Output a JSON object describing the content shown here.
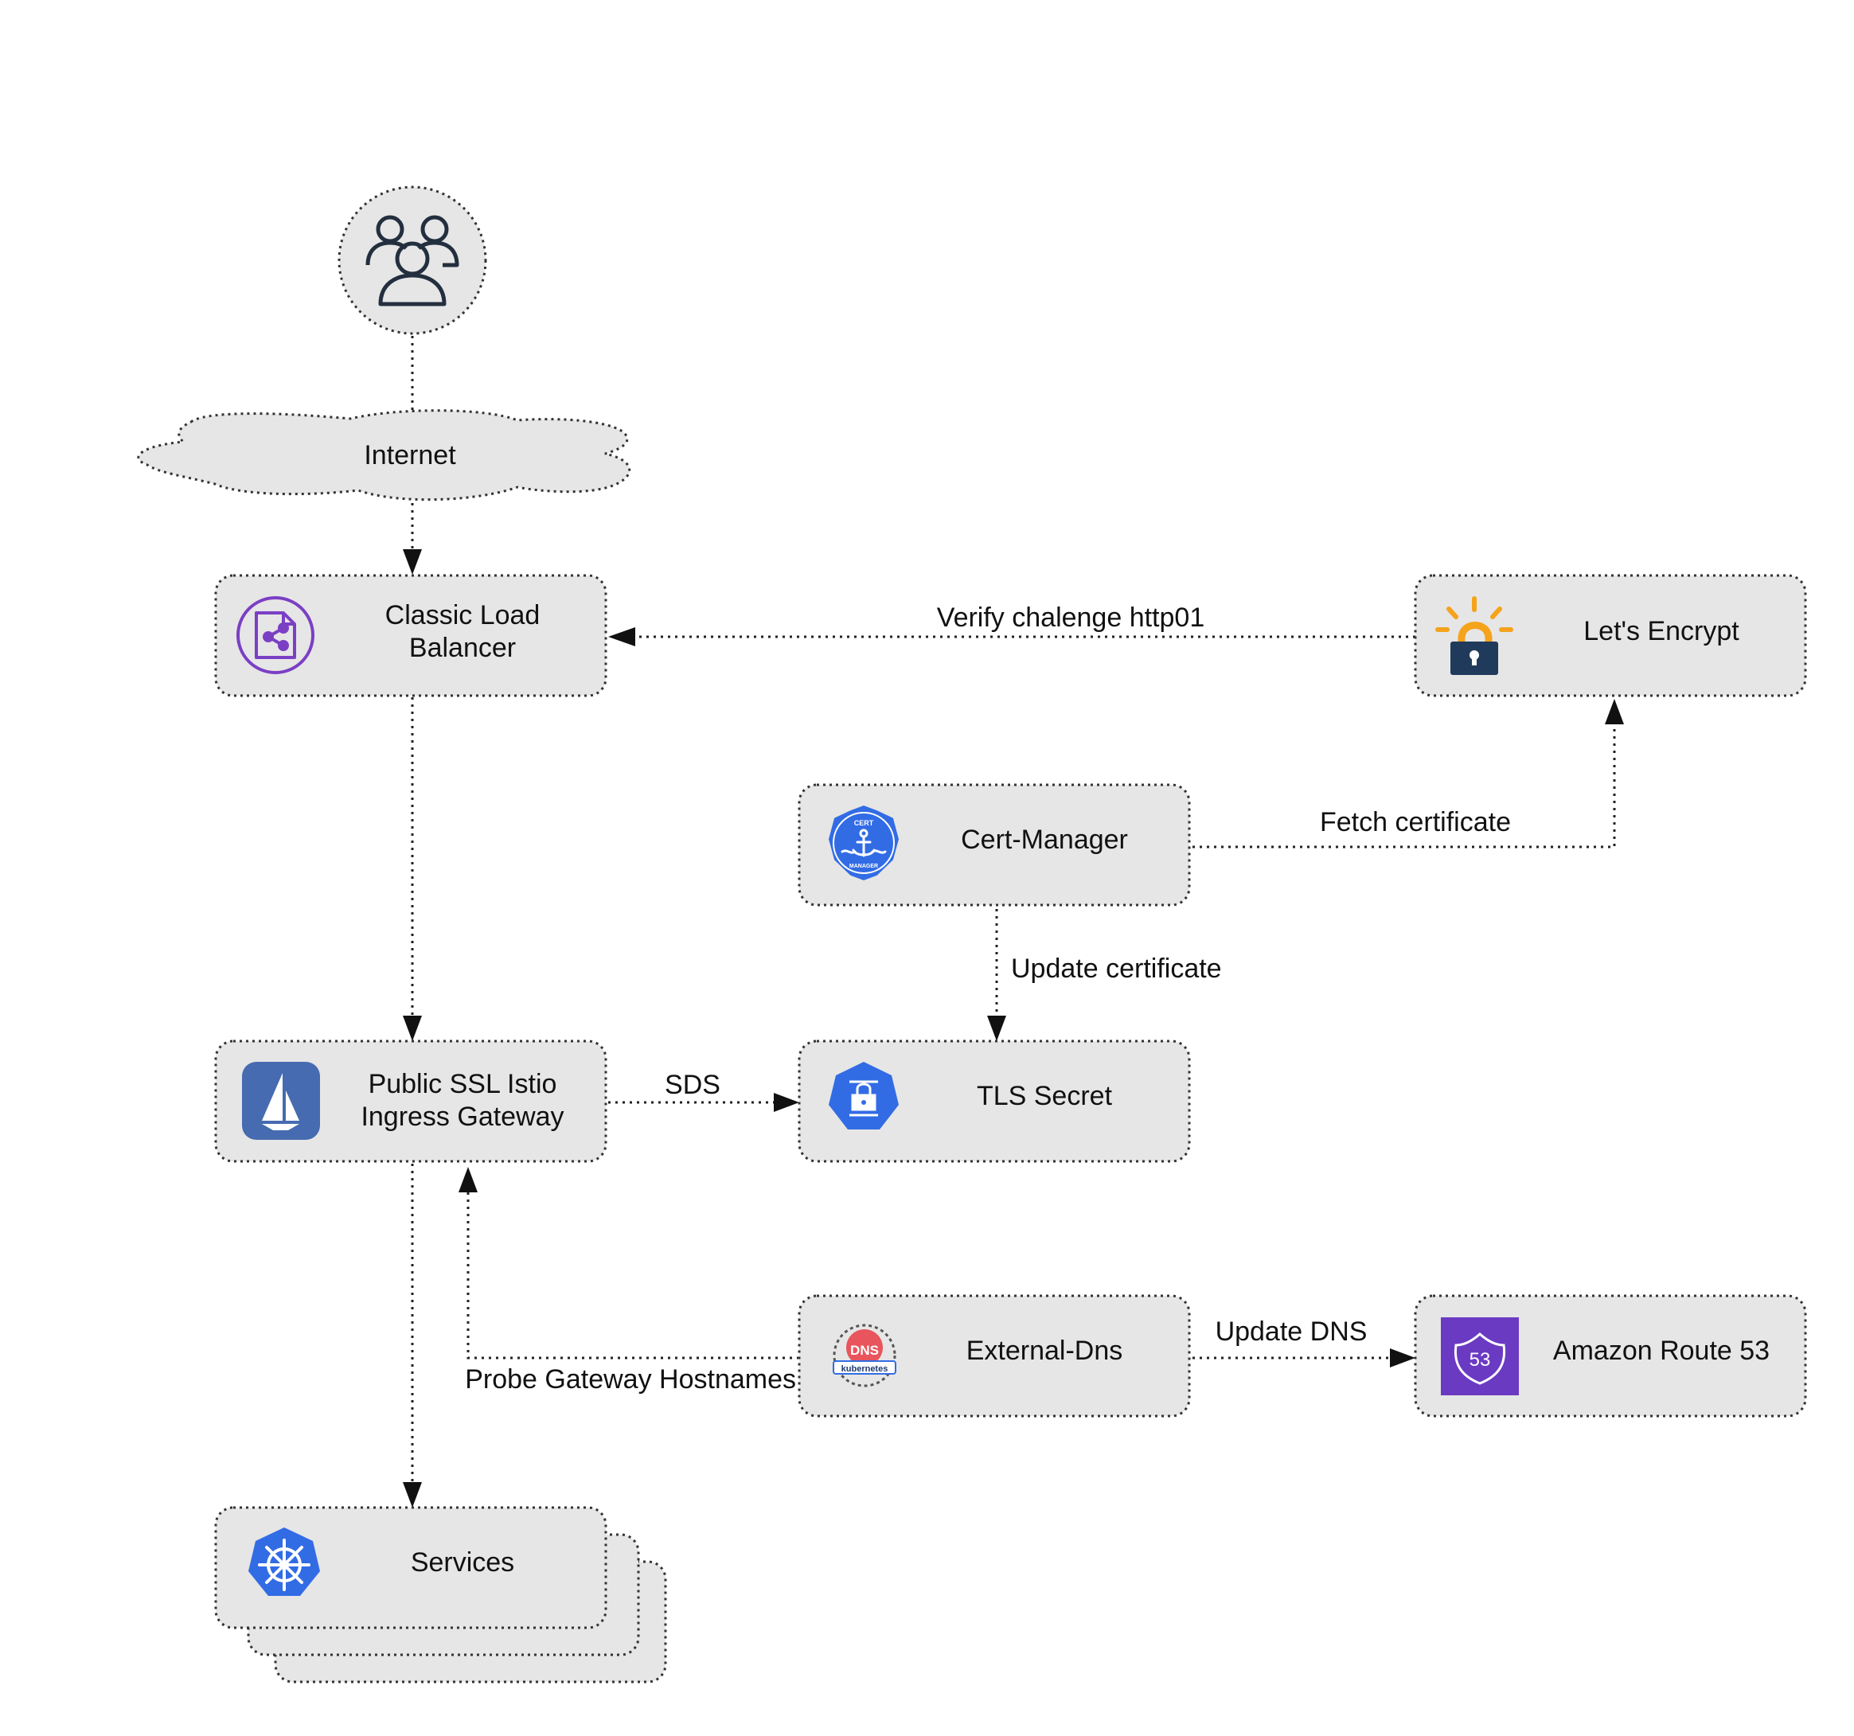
{
  "nodes": {
    "users": {
      "label": ""
    },
    "internet": {
      "label": "Internet"
    },
    "clb": {
      "label_lines": [
        "Classic Load",
        "Balancer"
      ]
    },
    "lets_encrypt": {
      "label": "Let's Encrypt"
    },
    "cert_manager": {
      "label": "Cert-Manager"
    },
    "istio_gateway": {
      "label_lines": [
        "Public SSL Istio",
        "Ingress Gateway"
      ]
    },
    "tls_secret": {
      "label": "TLS Secret"
    },
    "external_dns": {
      "label": "External-Dns"
    },
    "route53": {
      "label": "Amazon Route 53"
    },
    "services": {
      "label": "Services"
    }
  },
  "edges": {
    "verify": "Verify chalenge http01",
    "fetch": "Fetch certificate",
    "update_cert": "Update certificate",
    "sds": "SDS",
    "update_dns": "Update DNS",
    "probe": "Probe Gateway Hostnames"
  },
  "icons": {
    "users": "users-group-icon",
    "clb": "load-balancer-icon",
    "lets_encrypt": "lets-encrypt-lock-icon",
    "cert_manager": "cert-manager-icon",
    "istio": "istio-sail-icon",
    "tls": "kubernetes-secret-icon",
    "external_dns": "external-dns-icon",
    "route53": "route53-icon",
    "services": "kubernetes-helm-icon"
  },
  "icon_texts": {
    "cert_top": "CERT",
    "cert_bottom": "MANAGER",
    "dns_word": "DNS",
    "kubernetes_word": "kubernetes",
    "route53_number": "53"
  },
  "colors": {
    "box_fill": "#e6e6e6",
    "load_balancer_purple": "#7b3fc4",
    "lets_encrypt_orange": "#f4a31b",
    "lets_encrypt_navy": "#203a5c",
    "kubernetes_blue": "#326ce5",
    "istio_blue": "#466bb0",
    "route53_purple": "#6b3ac3",
    "dns_red": "#e8555c"
  }
}
